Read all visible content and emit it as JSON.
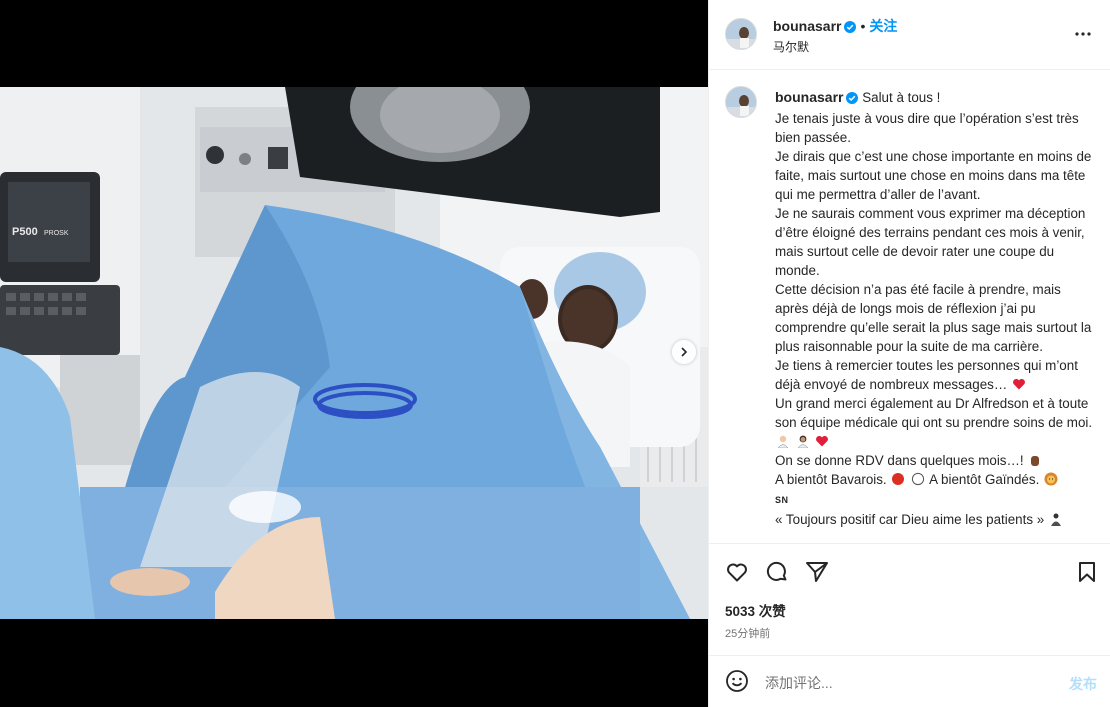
{
  "post": {
    "username": "bounasarr",
    "follow_label": "关注",
    "separator": "•",
    "location": "马尔默",
    "more_label": "More options"
  },
  "caption": {
    "username": "bounasarr",
    "first_line": "Salut à tous !",
    "paragraphs": [
      "Je tenais juste à vous dire que l’opération s’est très bien passée.",
      "Je dirais que c’est une chose importante en moins de faite, mais surtout une chose en moins dans ma tête qui me permettra d’aller de l’avant.",
      "Je ne saurais comment vous exprimer ma déception d’être éloigné des terrains pendant ces mois à venir, mais surtout celle de devoir rater une coupe du monde.",
      "Cette décision n’a pas été facile à prendre, mais après déjà de longs mois de réflexion j’ai pu comprendre qu’elle serait la plus sage mais surtout la plus raisonnable pour la suite de ma carrière."
    ],
    "thanks_line": "Je tiens à remercier toutes les personnes qui m’ont déjà envoyé de nombreux messages…",
    "doctor_line": "Un grand merci également au Dr Alfredson et à toute son équipe médicale qui ont su prendre soins de moi.",
    "rdv_line": "On se donne RDV dans quelques mois…!",
    "bavarois_line": "A bientôt Bavarois.",
    "gaindes_line": "A bientôt Gaïndés.",
    "sn_line": "SN",
    "quote_line": "« Toujours positif car Dieu aime les patients »"
  },
  "engagement": {
    "likes": "5033 次赞",
    "time": "25分钟前"
  },
  "composer": {
    "placeholder": "添加评论...",
    "post_label": "发布"
  },
  "colors": {
    "accent": "#0095f6",
    "verified": "#0095f6",
    "heart": "#ed4956",
    "drape": "#6fa8dc"
  },
  "icons": [
    "verified-icon",
    "more-icon",
    "heart-icon",
    "comment-icon",
    "share-icon",
    "save-icon",
    "emoji-icon",
    "chevron-right-icon"
  ]
}
